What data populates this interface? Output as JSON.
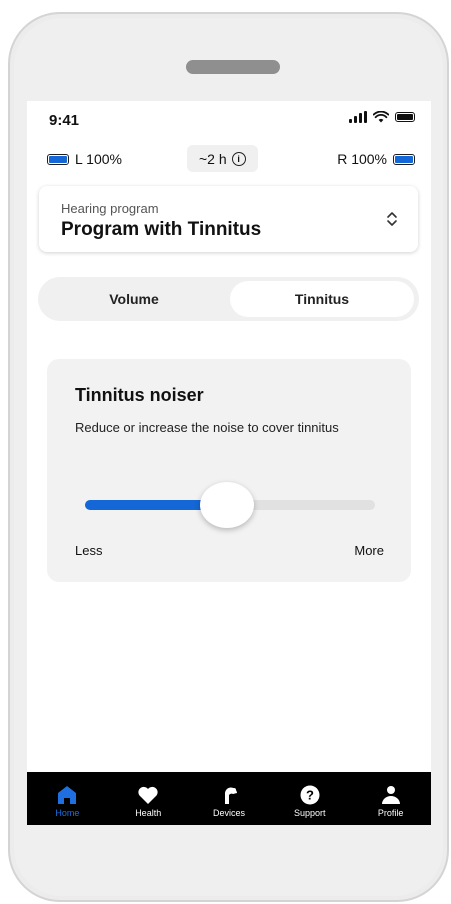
{
  "status_bar": {
    "time": "9:41"
  },
  "hearing_aids": {
    "left_label": "L 100%",
    "right_label": "R 100%",
    "remaining_time": "~2 h",
    "left_level": 1.0,
    "right_level": 1.0
  },
  "program": {
    "label": "Hearing program",
    "value": "Program with Tinnitus"
  },
  "tabs": [
    {
      "label": "Volume",
      "selected": false
    },
    {
      "label": "Tinnitus",
      "selected": true
    }
  ],
  "noiser": {
    "title": "Tinnitus noiser",
    "description": "Reduce or increase the noise to cover tinnitus",
    "min_label": "Less",
    "max_label": "More",
    "level": 0.49
  },
  "nav": [
    {
      "label": "Home",
      "icon": "home-icon",
      "active": true
    },
    {
      "label": "Health",
      "icon": "heart-icon",
      "active": false
    },
    {
      "label": "Devices",
      "icon": "hearing-aid-icon",
      "active": false
    },
    {
      "label": "Support",
      "icon": "help-icon",
      "active": false
    },
    {
      "label": "Profile",
      "icon": "person-icon",
      "active": false
    }
  ],
  "colors": {
    "accent": "#1566d6",
    "nav_background": "#000000",
    "card_background": "#f2f2f2"
  }
}
